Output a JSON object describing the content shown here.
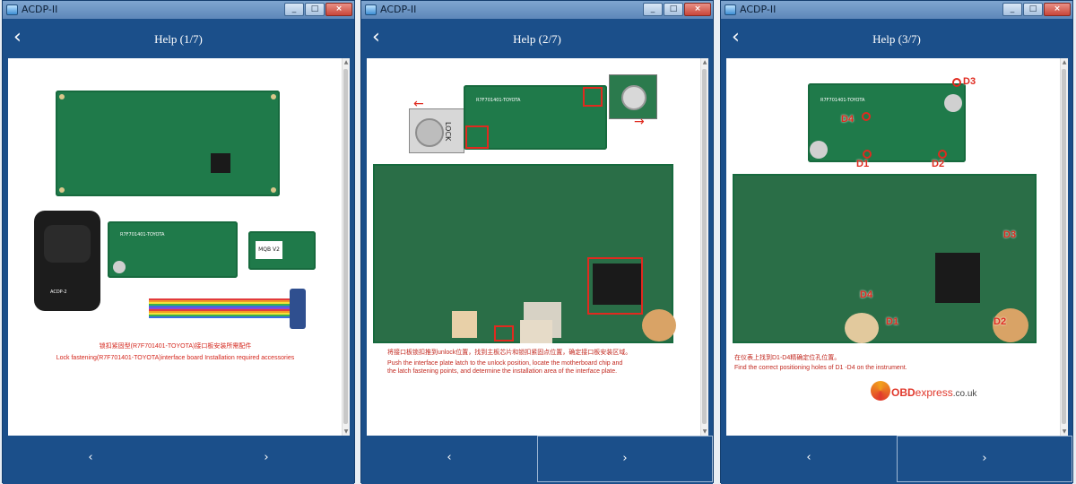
{
  "windows": [
    {
      "title": "ACDP-II",
      "help_title": "Help (1/7)",
      "prev_label": "‹",
      "next_label": "›",
      "back_label": "‹",
      "caption_cn": "锁扣紧固型(R7F701401-TOYOTA)接口板安装所需配件",
      "caption_en": "Lock fastening(R7F701401-TOYOTA)interface board Installation required accessories",
      "board_label": "R7F701401-TOYOTA",
      "device_label": "ACDP-2",
      "mqb_label": "MQB V2"
    },
    {
      "title": "ACDP-II",
      "help_title": "Help (2/7)",
      "prev_label": "‹",
      "next_label": "›",
      "back_label": "‹",
      "board_label": "R7F701401-TOYOTA",
      "lock_label": "LOCK",
      "caption_cn": "将接口板锁扣推到unlock位置，找到主板芯片和锁扣紧固点位置，确定接口板安装区域。",
      "caption_en_1": "Push the interface plate latch to the unlock position, locate the motherboard chip and",
      "caption_en_2": "the latch fastening points, and determine the installation area of the interface plate."
    },
    {
      "title": "ACDP-II",
      "help_title": "Help (3/7)",
      "prev_label": "‹",
      "next_label": "›",
      "back_label": "‹",
      "board_label": "R7F701401-TOYOTA",
      "markers": [
        "D1",
        "D2",
        "D3",
        "D4"
      ],
      "caption_cn": "在仪表上找到D1-D4精确定位孔位置。",
      "caption_en": "Find the correct positioning holes of D1 -D4 on the instrument.",
      "watermark_obd": "OBD",
      "watermark_rest": "express",
      "watermark_tld": ".co.uk"
    }
  ],
  "colors": {
    "header": "#1b4f8a",
    "caption_red": "#d4261c",
    "pcb_green": "#1f7a4a"
  }
}
